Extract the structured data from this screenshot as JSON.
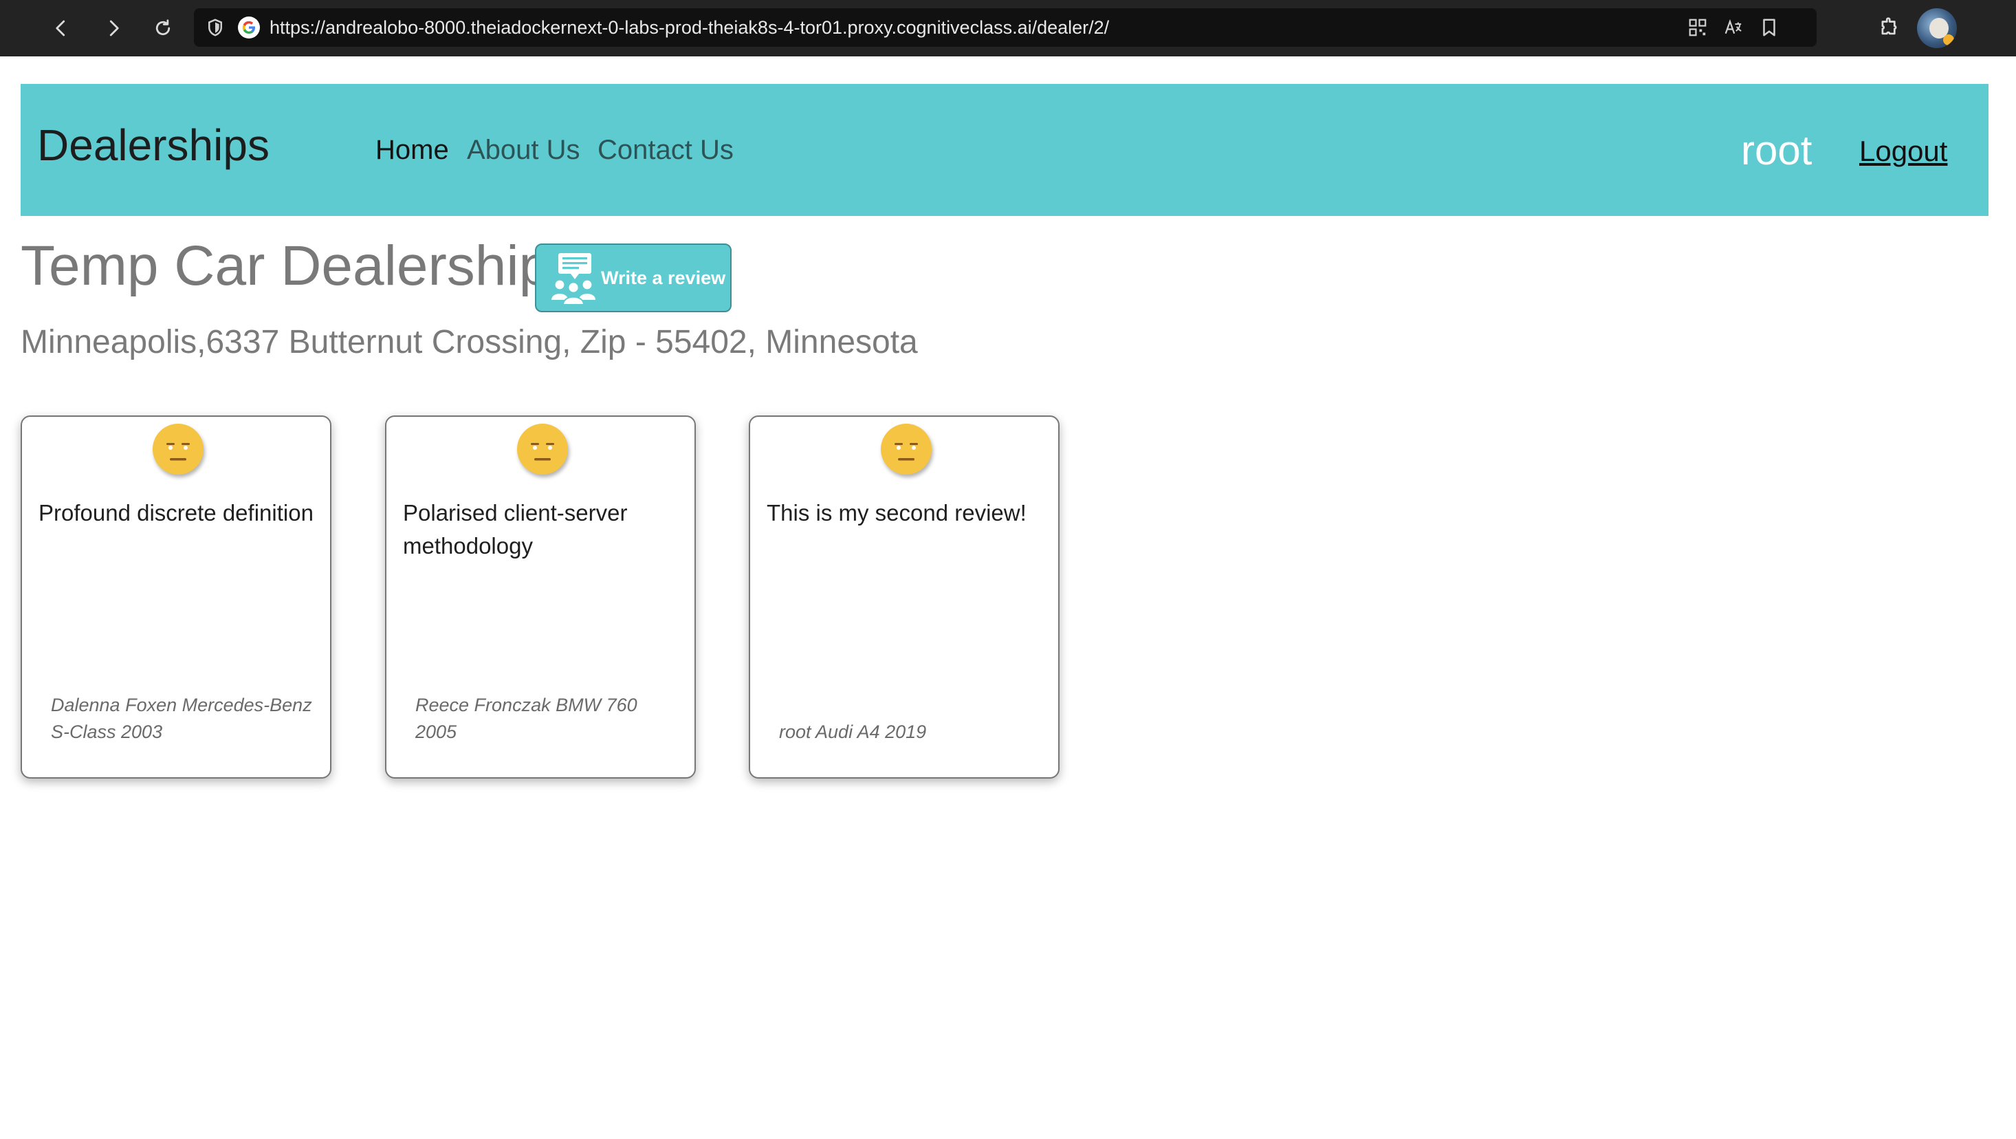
{
  "browser": {
    "url": "https://andrealobo-8000.theiadockernext-0-labs-prod-theiak8s-4-tor01.proxy.cognitiveclass.ai/dealer/2/"
  },
  "header": {
    "brand": "Dealerships",
    "nav": [
      {
        "label": "Home"
      },
      {
        "label": "About Us"
      },
      {
        "label": "Contact Us"
      }
    ],
    "username": "root",
    "logout_label": "Logout",
    "background_color": "#5ecbd1"
  },
  "dealer": {
    "name": "Temp Car Dealership",
    "write_review_label": "Write a review",
    "address": "Minneapolis,6337 Butternut Crossing, Zip - 55402, Minnesota"
  },
  "reviews": [
    {
      "sentiment_icon": "neutral-face",
      "text": "Profound discrete definition",
      "reviewer": "Dalenna Foxen Mercedes-Benz S-Class 2003"
    },
    {
      "sentiment_icon": "neutral-face",
      "text": "Polarised client-server methodology",
      "reviewer": "Reece Fronczak BMW 760 2005"
    },
    {
      "sentiment_icon": "neutral-face",
      "text": "This is my second review!",
      "reviewer": "root Audi A4 2019"
    }
  ]
}
